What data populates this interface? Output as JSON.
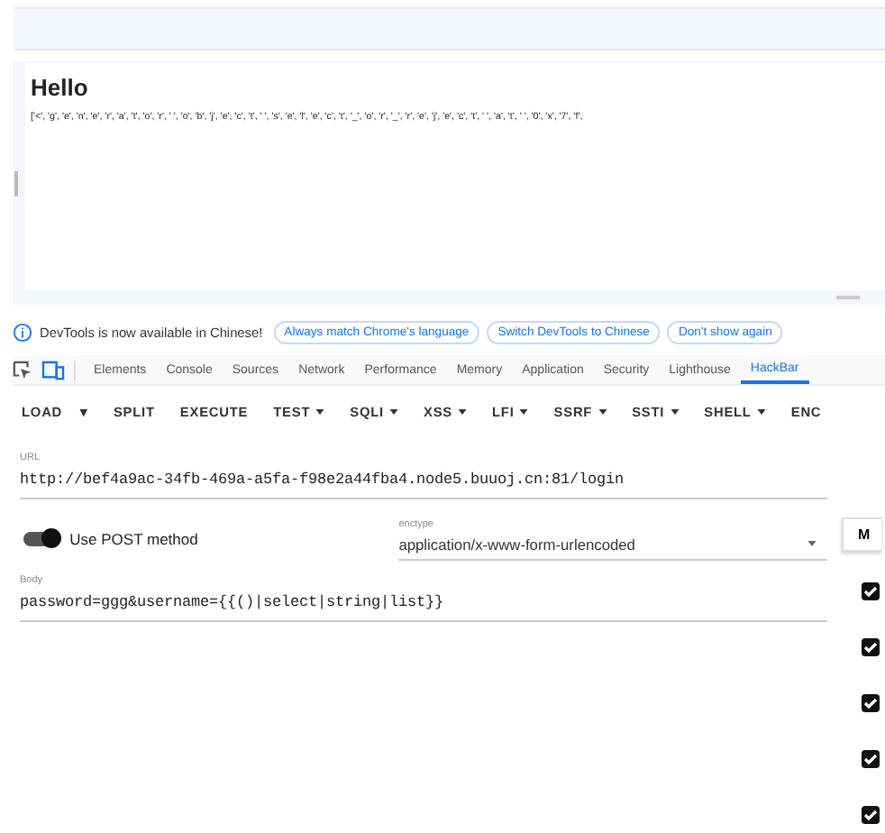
{
  "page": {
    "heading": "Hello",
    "output": "['<', 'g', 'e', 'n', 'e', 'r', 'a', 't', 'o', 'r', ' ', 'o', 'b', 'j', 'e', 'c', 't', ' ', 's', 'e', 'l', 'e', 'c', 't', '_', 'o', 'r', '_', 'r', 'e', 'j', 'e', 'c', 't', ' ', 'a', 't', ' ', '0', 'x', '7', 'f',"
  },
  "notice": {
    "text": "DevTools is now available in Chinese!",
    "buttons": [
      "Always match Chrome's language",
      "Switch DevTools to Chinese",
      "Don't show again"
    ]
  },
  "tabs": [
    {
      "label": "Elements",
      "selected": false
    },
    {
      "label": "Console",
      "selected": false
    },
    {
      "label": "Sources",
      "selected": false
    },
    {
      "label": "Network",
      "selected": false
    },
    {
      "label": "Performance",
      "selected": false
    },
    {
      "label": "Memory",
      "selected": false
    },
    {
      "label": "Application",
      "selected": false
    },
    {
      "label": "Security",
      "selected": false
    },
    {
      "label": "Lighthouse",
      "selected": false
    },
    {
      "label": "HackBar",
      "selected": true
    }
  ],
  "toolbar": [
    {
      "label": "LOAD",
      "dropdown": false
    },
    {
      "label": "▾",
      "dropdown": false
    },
    {
      "label": "SPLIT",
      "dropdown": false
    },
    {
      "label": "EXECUTE",
      "dropdown": false
    },
    {
      "label": "TEST",
      "dropdown": true
    },
    {
      "label": "SQLI",
      "dropdown": true
    },
    {
      "label": "XSS",
      "dropdown": true
    },
    {
      "label": "LFI",
      "dropdown": true
    },
    {
      "label": "SSRF",
      "dropdown": true
    },
    {
      "label": "SSTI",
      "dropdown": true
    },
    {
      "label": "SHELL",
      "dropdown": true
    },
    {
      "label": "ENC",
      "dropdown": false
    }
  ],
  "url": {
    "label": "URL",
    "value": "http://bef4a9ac-34fb-469a-a5fa-f98e2a44fba4.node5.buuoj.cn:81/login"
  },
  "post": {
    "label": "Use POST method",
    "on": true
  },
  "enctype": {
    "label": "enctype",
    "value": "application/x-www-form-urlencoded"
  },
  "side_button": "M",
  "body": {
    "label": "Body",
    "value": "password=ggg&username={{()|select|string|list}}"
  },
  "checks": [
    {
      "checked": true
    },
    {
      "checked": true
    },
    {
      "checked": true
    },
    {
      "checked": true
    },
    {
      "checked": true
    }
  ]
}
